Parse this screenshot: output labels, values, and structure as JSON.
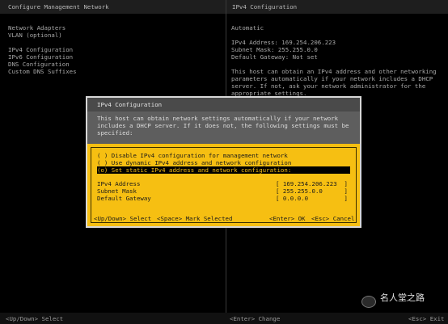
{
  "header": {
    "left_title": "Configure Management Network",
    "right_title": "IPv4 Configuration"
  },
  "menu": {
    "items": [
      "Network Adapters",
      "VLAN (optional)",
      "IPv4 Configuration",
      "IPv6 Configuration",
      "DNS Configuration",
      "Custom DNS Suffixes"
    ]
  },
  "info": {
    "mode": "Automatic",
    "ipv4_address": "IPv4 Address: 169.254.206.223",
    "subnet_mask": "Subnet Mask: 255.255.0.0",
    "default_gateway": "Default Gateway: Not set",
    "help": [
      "This host can obtain an IPv4 address and other networking",
      "parameters automatically if your network includes a DHCP",
      "server. If not, ask your network administrator for the",
      "appropriate settings."
    ]
  },
  "dialog": {
    "title": "IPv4 Configuration",
    "description": [
      "This host can obtain network settings automatically if your network",
      "includes a DHCP server. If it does not, the following settings must be",
      "specified:"
    ],
    "options": [
      "( ) Disable IPv4 configuration for management network",
      "( ) Use dynamic IPv4 address and network configuration",
      "(o) Set static IPv4 address and network configuration:"
    ],
    "fields": {
      "ip_label": "IPv4 Address",
      "ip_value": "[ 169.254.206.223  ]",
      "mask_label": "Subnet Mask",
      "mask_value": "[ 255.255.0.0      ]",
      "gw_label": "Default Gateway",
      "gw_value": "[ 0.0.0.0          ]"
    },
    "keys": {
      "updown": "<Up/Down> Select",
      "space": "<Space> Mark Selected",
      "enter": "<Enter> OK",
      "esc": "<Esc> Cancel"
    }
  },
  "footer": {
    "left": "<Up/Down> Select",
    "enter": "<Enter> Change",
    "esc": "<Esc> Exit"
  },
  "watermark": {
    "text": "名人堂之路"
  },
  "colors": {
    "dialog_body": "#f6bf12",
    "background": "#000000"
  }
}
